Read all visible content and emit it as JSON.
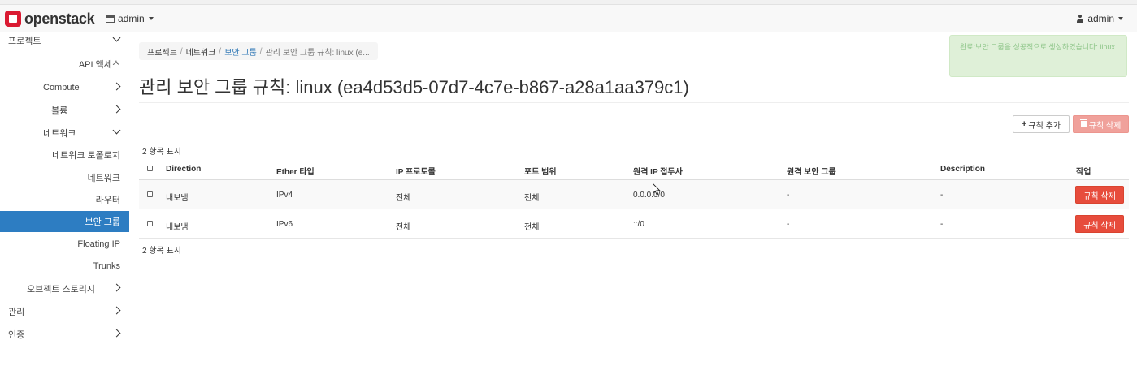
{
  "navbar": {
    "brand": "openstack",
    "project": "admin",
    "user": "admin"
  },
  "sidebar": {
    "project": "프로젝트",
    "api_access": "API 액세스",
    "compute": "Compute",
    "volume": "볼륨",
    "network": "네트워크",
    "network_topology": "네트워크 토폴로지",
    "networks": "네트워크",
    "routers": "라우터",
    "security_groups": "보안 그룹",
    "floating_ip": "Floating IP",
    "trunks": "Trunks",
    "object_storage": "오브젝트 스토리지",
    "admin": "관리",
    "identity": "인증"
  },
  "breadcrumb": {
    "project": "프로젝트",
    "network": "네트워크",
    "security_groups": "보안 그룹",
    "current": "관리 보안 그룹 규칙: linux (e..."
  },
  "page": {
    "title": "관리 보안 그룹 규칙: linux (ea4d53d5-07d7-4c7e-b867-a28a1aa379c1)",
    "add_rule": "규칙 추가",
    "delete_rules": "규칙 삭제",
    "count_top": "2 항목 표시",
    "count_bottom": "2 항목 표시"
  },
  "table": {
    "headers": {
      "direction": "Direction",
      "ether": "Ether 타입",
      "protocol": "IP 프로토콜",
      "port": "포트 범위",
      "remote_ip": "원격 IP 접두사",
      "remote_group": "원격 보안 그룹",
      "description": "Description",
      "actions": "작업"
    },
    "rows": [
      {
        "direction": "내보냄",
        "ether": "IPv4",
        "protocol": "전체",
        "port": "전체",
        "remote_ip": "0.0.0.0/0",
        "remote_group": "-",
        "description": "-",
        "action": "규칙 삭제"
      },
      {
        "direction": "내보냄",
        "ether": "IPv6",
        "protocol": "전체",
        "port": "전체",
        "remote_ip": "::/0",
        "remote_group": "-",
        "description": "-",
        "action": "규칙 삭제"
      }
    ]
  },
  "toast": {
    "message": "완료:보안 그룹을 성공적으로 생성하였습니다: linux"
  },
  "colors": {
    "brand": "#da1a32",
    "active": "#2d7dc2",
    "danger": "#e74c3c",
    "link": "#337ab7"
  }
}
